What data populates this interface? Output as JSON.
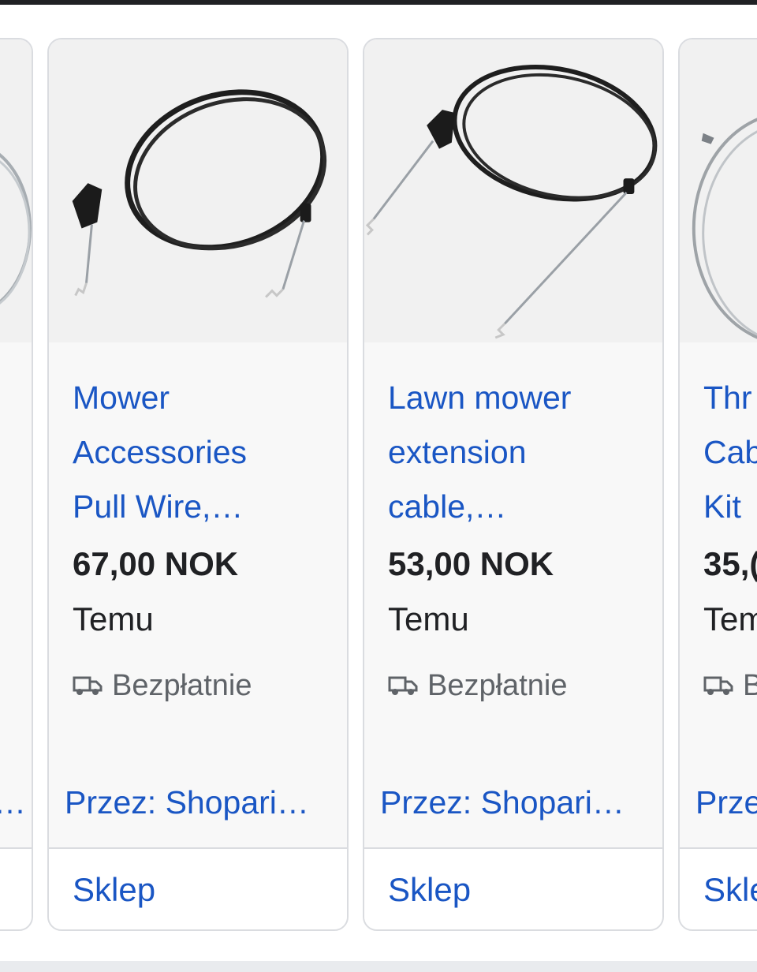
{
  "products": [
    {
      "title_lines": [
        "",
        "",
        ""
      ],
      "price": "",
      "store": "",
      "shipping": "",
      "via": "…",
      "shop_label": ""
    },
    {
      "title_lines": [
        "Mower",
        "Accessories",
        "Pull Wire,…"
      ],
      "price": "67,00 NOK",
      "store": "Temu",
      "shipping": "Bezpłatnie",
      "via": "Przez: Shopari…",
      "shop_label": "Sklep"
    },
    {
      "title_lines": [
        "Lawn mower",
        "extension",
        "cable,…"
      ],
      "price": "53,00 NOK",
      "store": "Temu",
      "shipping": "Bezpłatnie",
      "via": "Przez: Shopari…",
      "shop_label": "Sklep"
    },
    {
      "title_lines": [
        "Thr",
        "Cab",
        "Kit"
      ],
      "price": "35,(",
      "store": "Tem",
      "shipping": "B",
      "via": "Prze",
      "shop_label": "Skle"
    }
  ],
  "icons": {
    "shipping": "truck-icon"
  },
  "colors": {
    "link": "#1a56c4",
    "text": "#202124",
    "muted": "#5f6368",
    "border": "#dadce0"
  }
}
